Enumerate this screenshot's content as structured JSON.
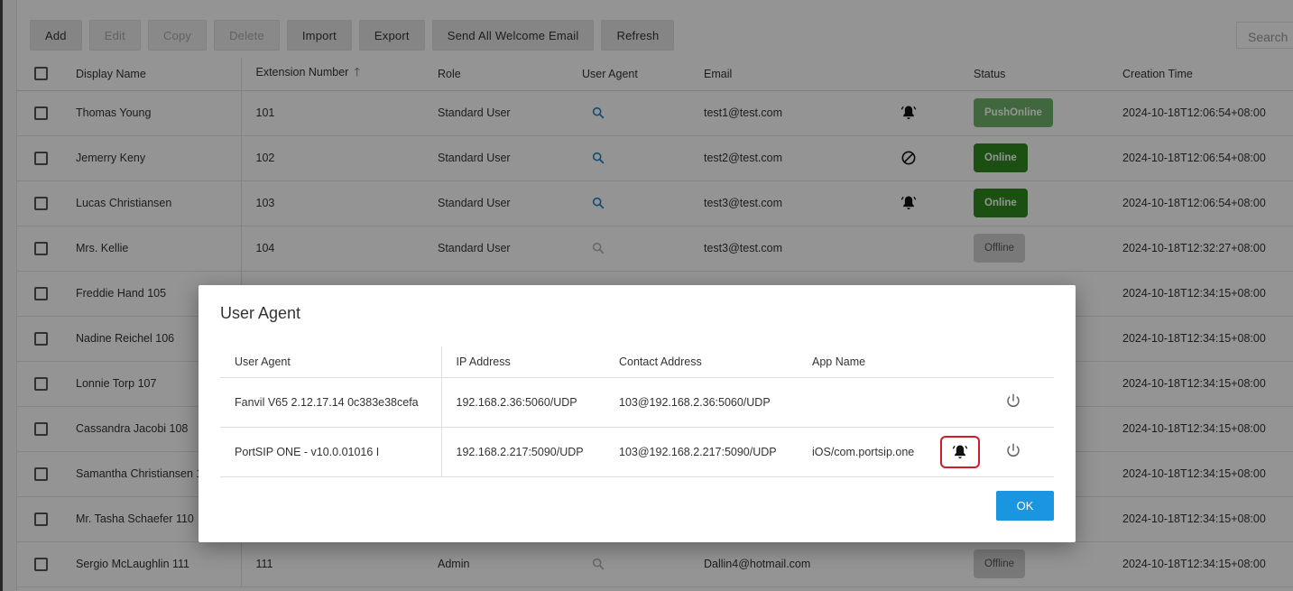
{
  "toolbar": {
    "add": "Add",
    "edit": "Edit",
    "copy": "Copy",
    "delete": "Delete",
    "import": "Import",
    "export": "Export",
    "send_welcome": "Send All Welcome Email",
    "refresh": "Refresh"
  },
  "search": {
    "placeholder": "Search"
  },
  "users_table": {
    "headers": {
      "display_name": "Display Name",
      "extension": "Extension Number",
      "role": "Role",
      "user_agent": "User Agent",
      "email": "Email",
      "status": "Status",
      "creation_time": "Creation Time"
    },
    "rows": [
      {
        "name": "Thomas Young",
        "ext": "101",
        "role": "Standard User",
        "email": "test1@test.com",
        "status": "PushOnline",
        "time": "2024-10-18T12:06:54+08:00"
      },
      {
        "name": "Jemerry Keny",
        "ext": "102",
        "role": "Standard User",
        "email": "test2@test.com",
        "status": "Online",
        "time": "2024-10-18T12:06:54+08:00"
      },
      {
        "name": "Lucas Christiansen",
        "ext": "103",
        "role": "Standard User",
        "email": "test3@test.com",
        "status": "Online",
        "time": "2024-10-18T12:06:54+08:00"
      },
      {
        "name": "Mrs. Kellie",
        "ext": "104",
        "role": "Standard User",
        "email": "test3@test.com",
        "status": "Offline",
        "time": "2024-10-18T12:32:27+08:00"
      },
      {
        "name": "Freddie Hand 105",
        "ext": "",
        "role": "",
        "email": "",
        "status": "",
        "time": "2024-10-18T12:34:15+08:00"
      },
      {
        "name": "Nadine Reichel 106",
        "ext": "",
        "role": "",
        "email": "",
        "status": "",
        "time": "2024-10-18T12:34:15+08:00"
      },
      {
        "name": "Lonnie Torp 107",
        "ext": "",
        "role": "",
        "email": "",
        "status": "",
        "time": "2024-10-18T12:34:15+08:00"
      },
      {
        "name": "Cassandra Jacobi 108",
        "ext": "",
        "role": "",
        "email": "",
        "status": "",
        "time": "2024-10-18T12:34:15+08:00"
      },
      {
        "name": "Samantha Christiansen 1",
        "ext": "",
        "role": "",
        "email": "",
        "status": "",
        "time": "2024-10-18T12:34:15+08:00"
      },
      {
        "name": "Mr. Tasha Schaefer 110",
        "ext": "",
        "role": "",
        "email": "",
        "status": "",
        "time": "2024-10-18T12:34:15+08:00"
      },
      {
        "name": "Sergio McLaughlin 111",
        "ext": "111",
        "role": "Admin",
        "email": "Dallin4@hotmail.com",
        "status": "Offline",
        "time": "2024-10-18T12:34:15+08:00"
      }
    ]
  },
  "dialog": {
    "title": "User Agent",
    "headers": {
      "user_agent": "User Agent",
      "ip": "IP Address",
      "contact": "Contact Address",
      "app": "App Name"
    },
    "rows": [
      {
        "ua": "Fanvil V65 2.12.17.14 0c383e38cefa",
        "ip": "192.168.2.36:5060/UDP",
        "contact": "103@192.168.2.36:5060/UDP",
        "app": ""
      },
      {
        "ua": "PortSIP ONE - v10.0.01016 I",
        "ip": "192.168.2.217:5090/UDP",
        "contact": "103@192.168.2.217:5090/UDP",
        "app": "iOS/com.portsip.one"
      }
    ],
    "ok": "OK"
  },
  "colors": {
    "accent": "#1a96e0",
    "online": "#2f8a1f",
    "push_online": "#6fb26a",
    "offline": "#d0d0d0",
    "highlight": "#d11a2a"
  }
}
